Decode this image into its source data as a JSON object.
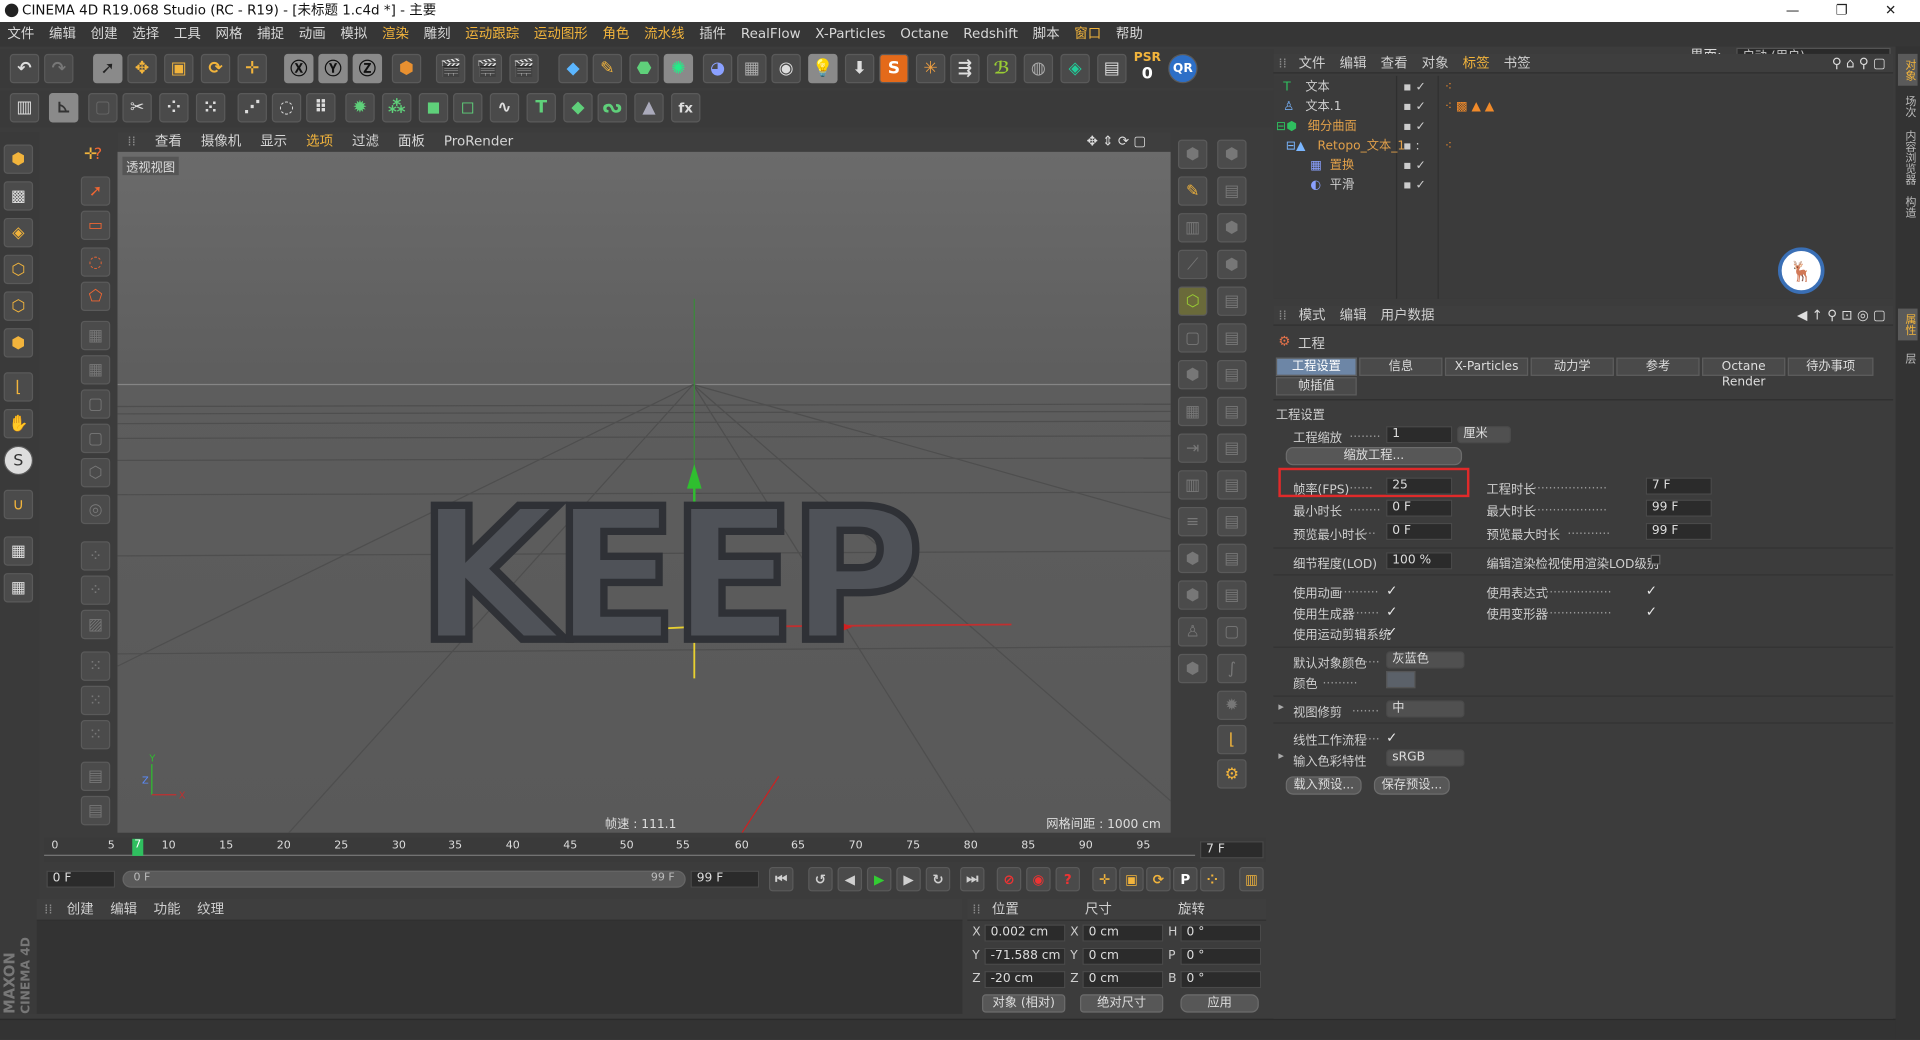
{
  "window": {
    "title": "CINEMA 4D R19.068 Studio (RC - R19) - [未标题 1.c4d *] - 主要"
  },
  "menu": [
    "文件",
    "编辑",
    "创建",
    "选择",
    "工具",
    "网格",
    "捕捉",
    "动画",
    "模拟",
    "渲染",
    "雕刻",
    "运动跟踪",
    "运动图形",
    "角色",
    "流水线",
    "插件",
    "RealFlow",
    "X-Particles",
    "Octane",
    "Redshift",
    "脚本",
    "窗口",
    "帮助"
  ],
  "layout": {
    "label": "界面:",
    "value": "启动 (用户)"
  },
  "psr": {
    "label": "PSR",
    "value": "0"
  },
  "viewport": {
    "menu": [
      "查看",
      "摄像机",
      "显示",
      "选项",
      "过滤",
      "面板",
      "ProRender"
    ],
    "name": "透视视图",
    "speed": "帧速 : 111.1",
    "grid": "网格间距 : 1000 cm",
    "model_text": "KEEP",
    "axis_y": "Y",
    "axis_x": "X",
    "axis_z": "Z"
  },
  "object_manager": {
    "menu": [
      "文件",
      "编辑",
      "查看",
      "对象",
      "标签",
      "书签"
    ],
    "objects": [
      {
        "name": "文本",
        "indent": 0,
        "color": "#d9d9d9"
      },
      {
        "name": "文本.1",
        "indent": 0,
        "color": "#d9d9d9"
      },
      {
        "name": "细分曲面",
        "indent": 0,
        "color": "#e1a04a"
      },
      {
        "name": "Retopo_文本_1",
        "indent": 1,
        "color": "#e1a04a"
      },
      {
        "name": "置换",
        "indent": 2,
        "color": "#d9d9d9"
      },
      {
        "name": "平滑",
        "indent": 2,
        "color": "#d9d9d9"
      }
    ]
  },
  "attributes": {
    "menu": [
      "模式",
      "编辑",
      "用户数据"
    ],
    "title": "工程",
    "tabs": [
      "工程设置",
      "信息",
      "X-Particles",
      "动力学",
      "参考",
      "Octane Render",
      "待办事项"
    ],
    "tab2": "帧插值",
    "section": "工程设置",
    "scale_label": "工程缩放",
    "scale_value": "1",
    "scale_unit": "厘米",
    "scale_button": "缩放工程...",
    "fps_label": "帧率(FPS)",
    "fps_value": "25",
    "length_label": "工程时长",
    "length_value": "7 F",
    "min_label": "最小时长",
    "min_value": "0 F",
    "max_label": "最大时长",
    "max_value": "99 F",
    "pmin_label": "预览最小时长",
    "pmin_value": "0 F",
    "pmax_label": "预览最大时长",
    "pmax_value": "99 F",
    "lod_label": "细节程度(LOD)",
    "lod_value": "100 %",
    "lod_check_label": "编辑渲染检视使用渲染LOD级别",
    "anim_label": "使用动画",
    "expr_label": "使用表达式",
    "gen_label": "使用生成器",
    "deform_label": "使用变形器",
    "motion_label": "使用运动剪辑系统",
    "color_label": "默认对象颜色",
    "color_value": "灰蓝色",
    "color2_label": "颜色",
    "clip_label": "视图修剪",
    "clip_value": "中",
    "linear_label": "线性工作流程",
    "input_label": "输入色彩特性",
    "input_value": "sRGB",
    "load_btn": "载入预设...",
    "save_btn": "保存预设..."
  },
  "timeline": {
    "ticks": [
      "0",
      "5",
      "10",
      "15",
      "20",
      "25",
      "30",
      "35",
      "40",
      "45",
      "50",
      "55",
      "60",
      "65",
      "70",
      "75",
      "80",
      "85",
      "90",
      "95"
    ],
    "current": "7",
    "end_field": "7 F",
    "start": "0 F",
    "slider_start": "0 F",
    "slider_end": "99 F",
    "end": "99 F"
  },
  "material": {
    "menu": [
      "创建",
      "编辑",
      "功能",
      "纹理"
    ],
    "brand_top": "MAXON",
    "brand_bottom": "CINEMA 4D"
  },
  "coords": {
    "headers": [
      "位置",
      "尺寸",
      "旋转"
    ],
    "rows": [
      {
        "axis": "X",
        "pos": "0.002 cm",
        "saxis": "X",
        "size": "0 cm",
        "raxis": "H",
        "rot": "0 °"
      },
      {
        "axis": "Y",
        "pos": "-71.588 cm",
        "saxis": "Y",
        "size": "0 cm",
        "raxis": "P",
        "rot": "0 °"
      },
      {
        "axis": "Z",
        "pos": "-20 cm",
        "saxis": "Z",
        "size": "0 cm",
        "raxis": "B",
        "rot": "0 °"
      }
    ],
    "mode1": "对象 (相对)",
    "mode2": "绝对尺寸",
    "apply": "应用"
  },
  "right_tabs": [
    "对象",
    "场次",
    "内容浏览器",
    "构造",
    "属性",
    "层"
  ],
  "colors": {
    "accent": "#f2b43c",
    "highlight_box": "#e02a2a",
    "tab_active": "#6d86a6"
  }
}
